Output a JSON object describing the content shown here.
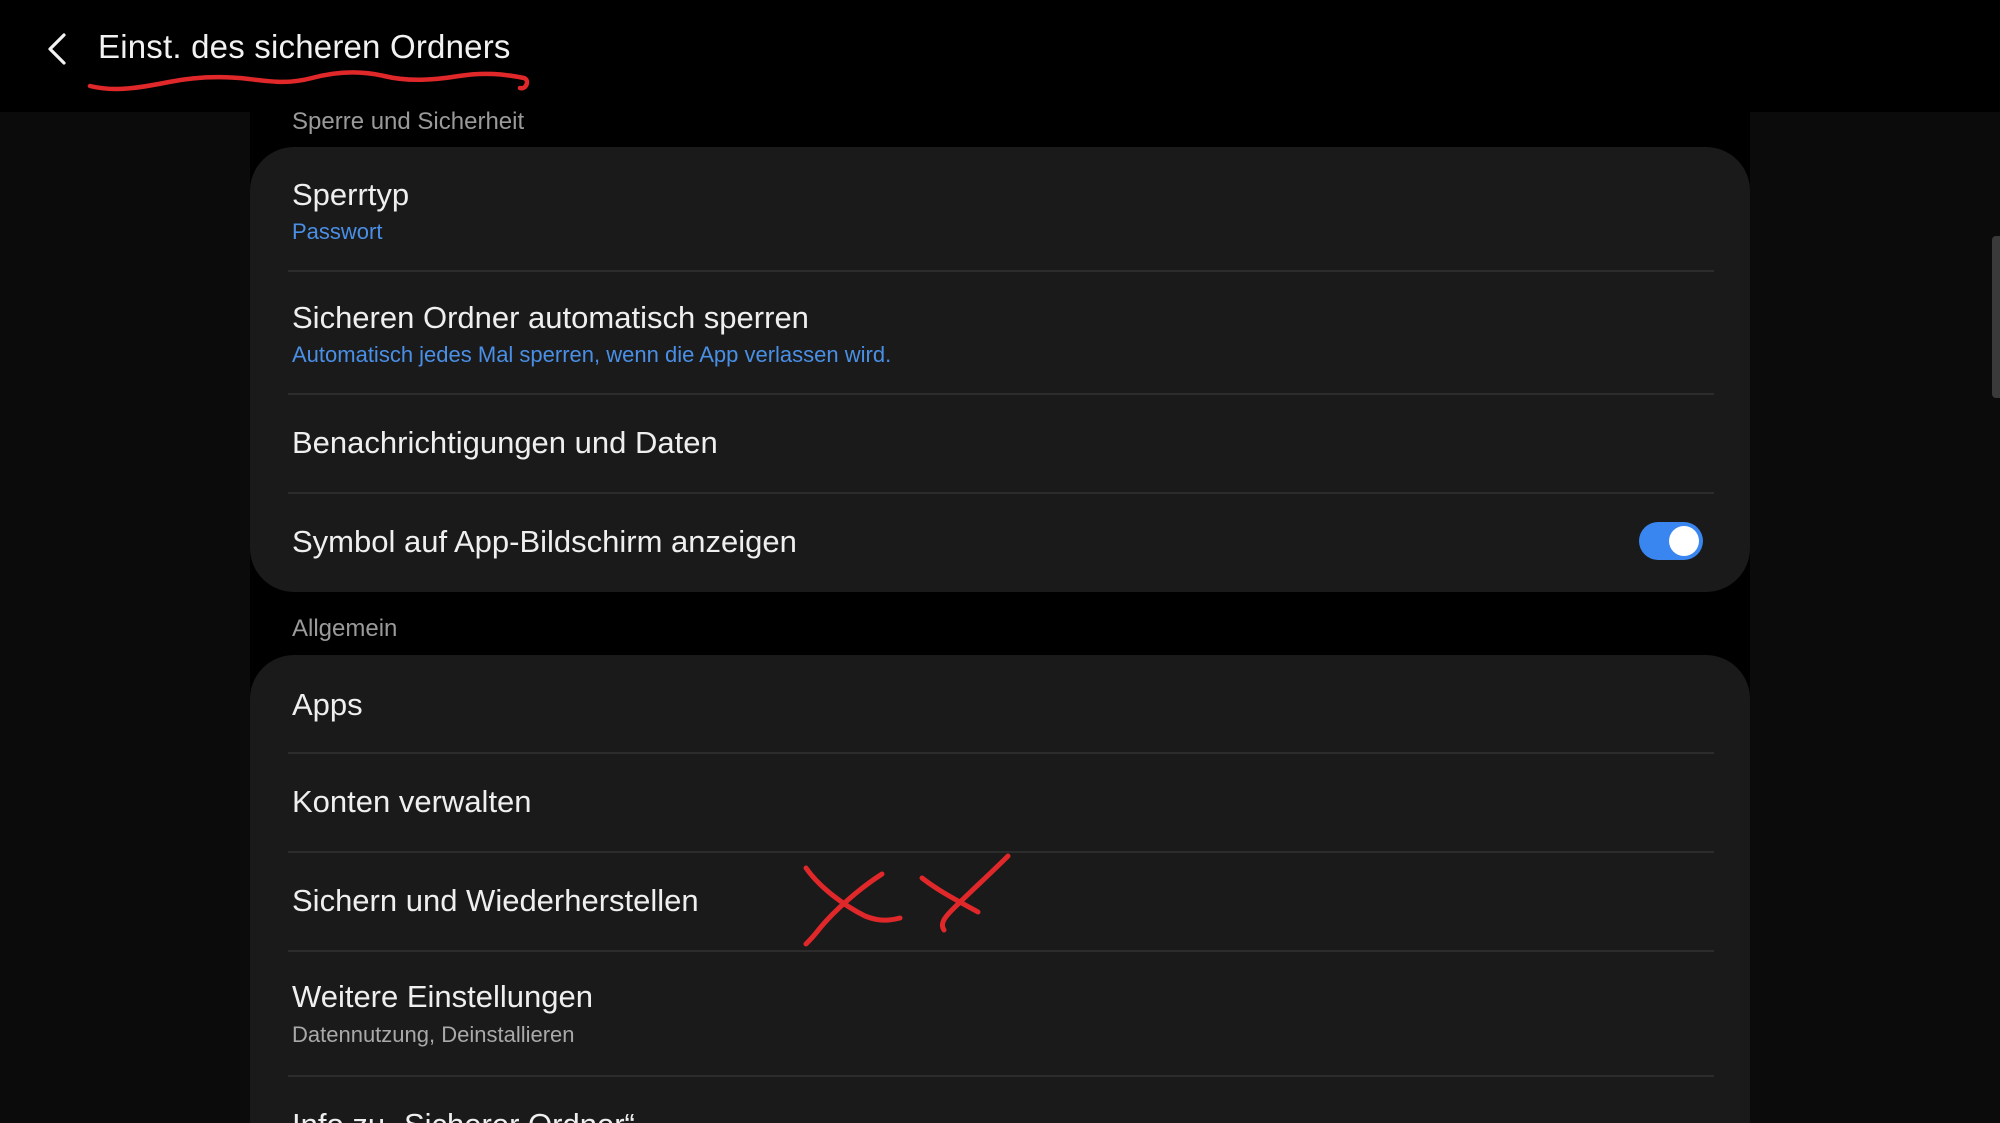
{
  "header": {
    "title": "Einst. des sicheren Ordners",
    "back_icon": "chevron-left-icon"
  },
  "sections": [
    {
      "header": "Sperre und Sicherheit",
      "items": [
        {
          "title": "Sperrtyp",
          "subtitle": "Passwort"
        },
        {
          "title": "Sicheren Ordner automatisch sperren",
          "subtitle": "Automatisch jedes Mal sperren, wenn die App verlassen wird."
        },
        {
          "title": "Benachrichtigungen und Daten"
        },
        {
          "title": "Symbol auf App-Bildschirm anzeigen",
          "toggle_on": true
        }
      ]
    },
    {
      "header": "Allgemein",
      "items": [
        {
          "title": "Apps"
        },
        {
          "title": "Konten verwalten"
        },
        {
          "title": "Sichern und Wiederherstellen"
        },
        {
          "title": "Weitere Einstellungen",
          "subtitle": "Datennutzung, Deinstallieren"
        },
        {
          "title": "Info zu „Sicherer Ordner“"
        }
      ]
    }
  ],
  "colors": {
    "background": "#000000",
    "card": "#1a1a1a",
    "accent": "#4a8fe6",
    "toggle_on": "#3a86f0",
    "annotation": "#e0282a"
  }
}
